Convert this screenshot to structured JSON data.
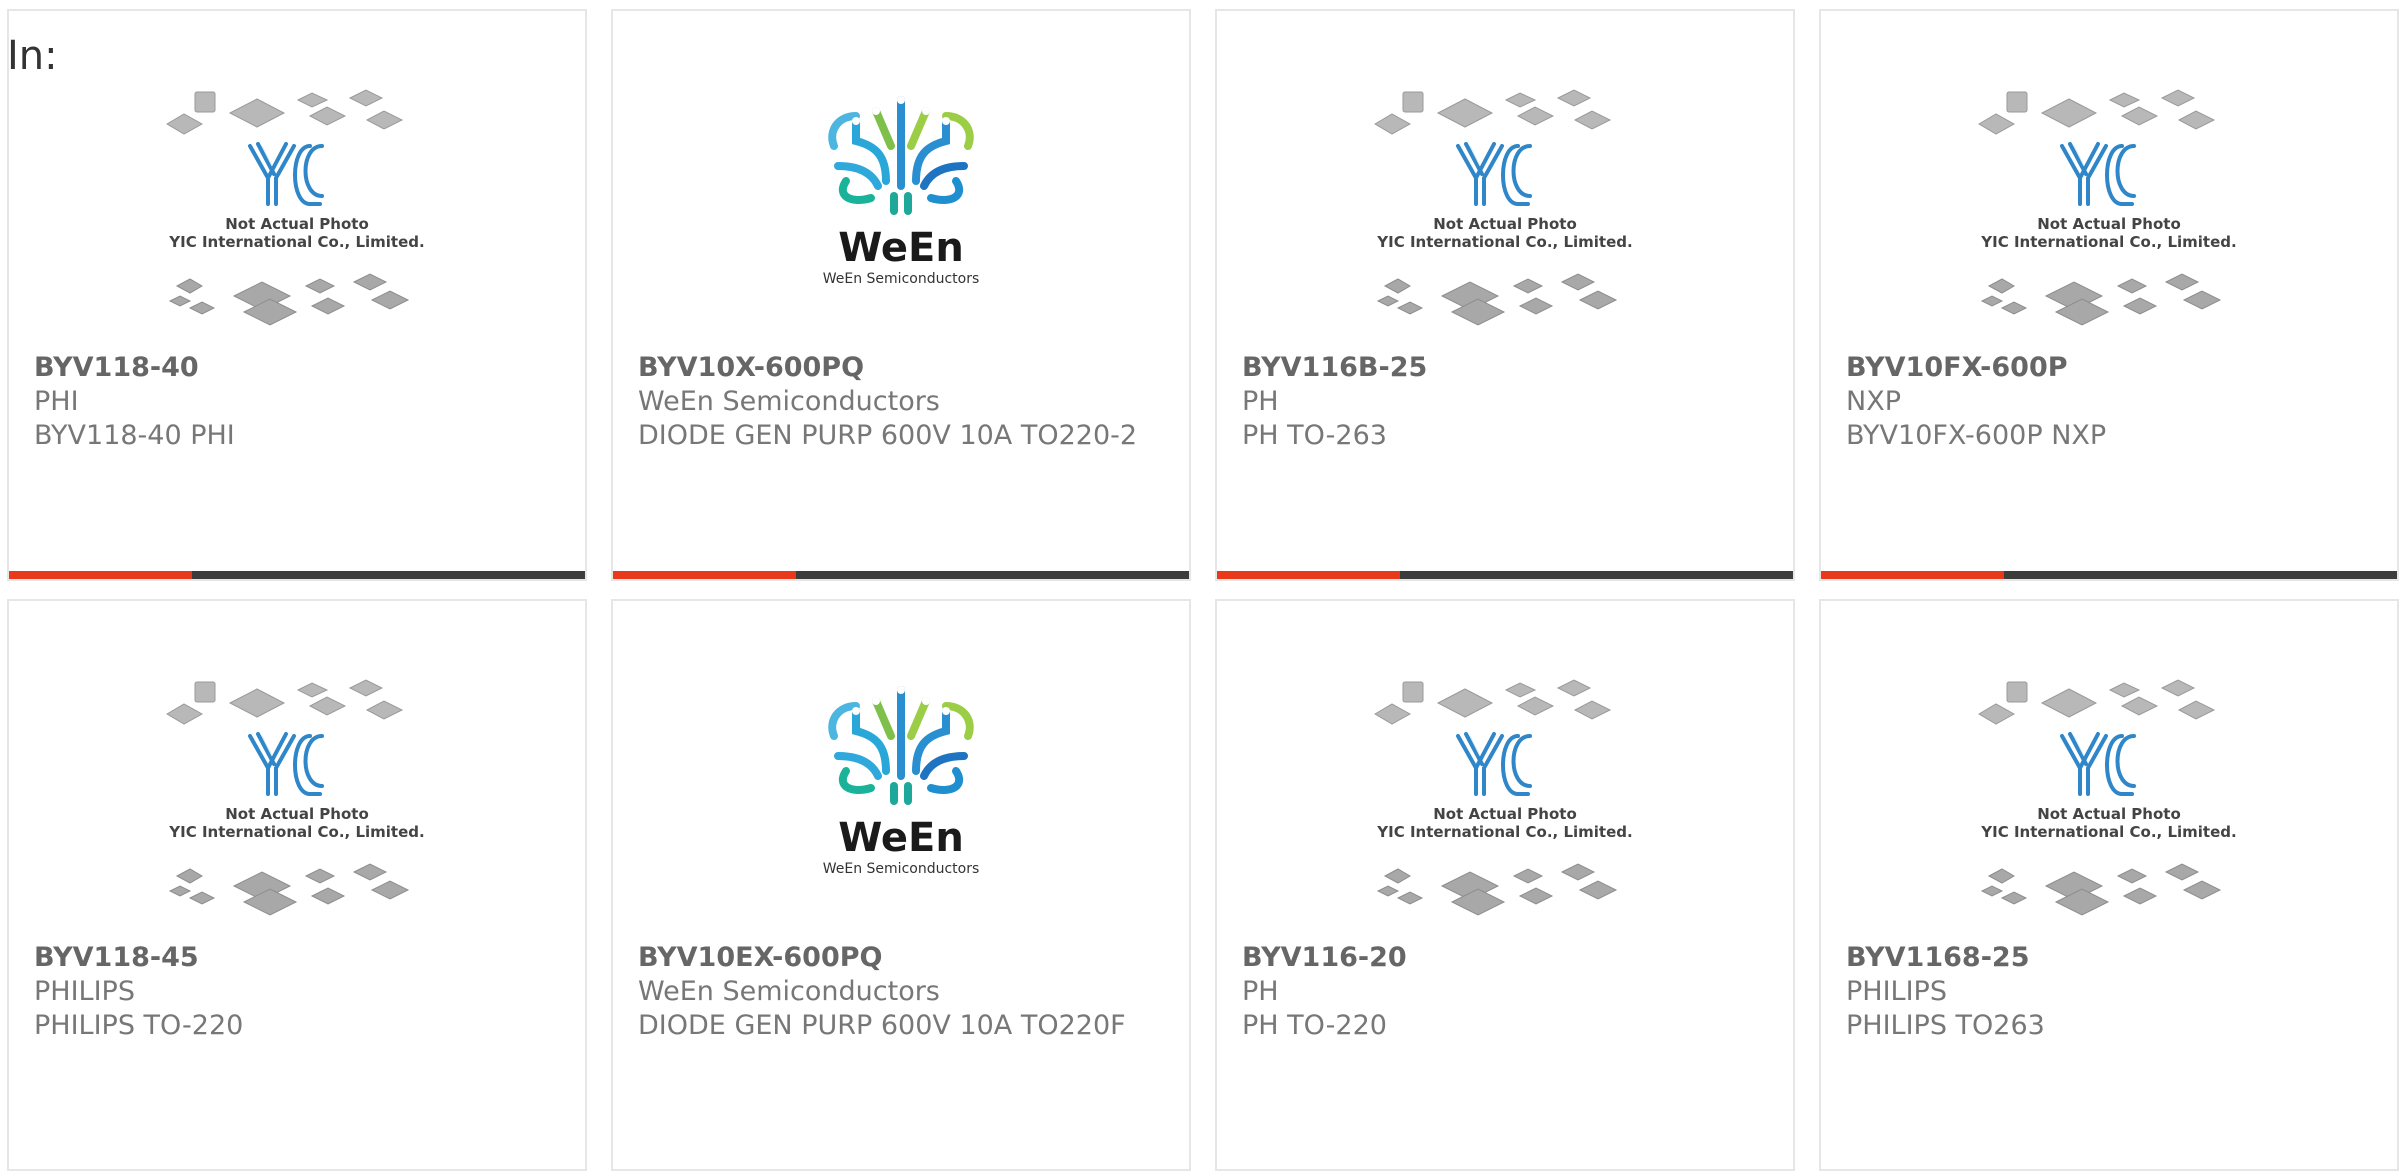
{
  "heading": "In:",
  "colors": {
    "accent": "#e8391b",
    "bar": "#3c3c3c",
    "border": "#e6e6e6",
    "text": "#777777"
  },
  "placeholder_logo": {
    "line1": "Not Actual Photo",
    "line2": "YIC International Co., Limited."
  },
  "ween_logo": {
    "title": "WeEn",
    "subtitle": "WeEn Semiconductors"
  },
  "products": [
    {
      "part": "BYV118-40",
      "mfr": "PHI",
      "desc": "BYV118-40 PHI",
      "image": "yic-placeholder"
    },
    {
      "part": "BYV10X-600PQ",
      "mfr": "WeEn Semiconductors",
      "desc": "DIODE GEN PURP 600V 10A TO220-2",
      "image": "ween-logo"
    },
    {
      "part": "BYV116B-25",
      "mfr": "PH",
      "desc": "PH TO-263",
      "image": "yic-placeholder"
    },
    {
      "part": "BYV10FX-600P",
      "mfr": "NXP",
      "desc": "BYV10FX-600P NXP",
      "image": "yic-placeholder"
    },
    {
      "part": "BYV118-45",
      "mfr": "PHILIPS",
      "desc": "PHILIPS TO-220",
      "image": "yic-placeholder"
    },
    {
      "part": "BYV10EX-600PQ",
      "mfr": "WeEn Semiconductors",
      "desc": "DIODE GEN PURP 600V 10A TO220F",
      "image": "ween-logo"
    },
    {
      "part": "BYV116-20",
      "mfr": "PH",
      "desc": "PH TO-220",
      "image": "yic-placeholder"
    },
    {
      "part": "BYV1168-25",
      "mfr": "PHILIPS",
      "desc": "PHILIPS TO263",
      "image": "yic-placeholder"
    }
  ]
}
